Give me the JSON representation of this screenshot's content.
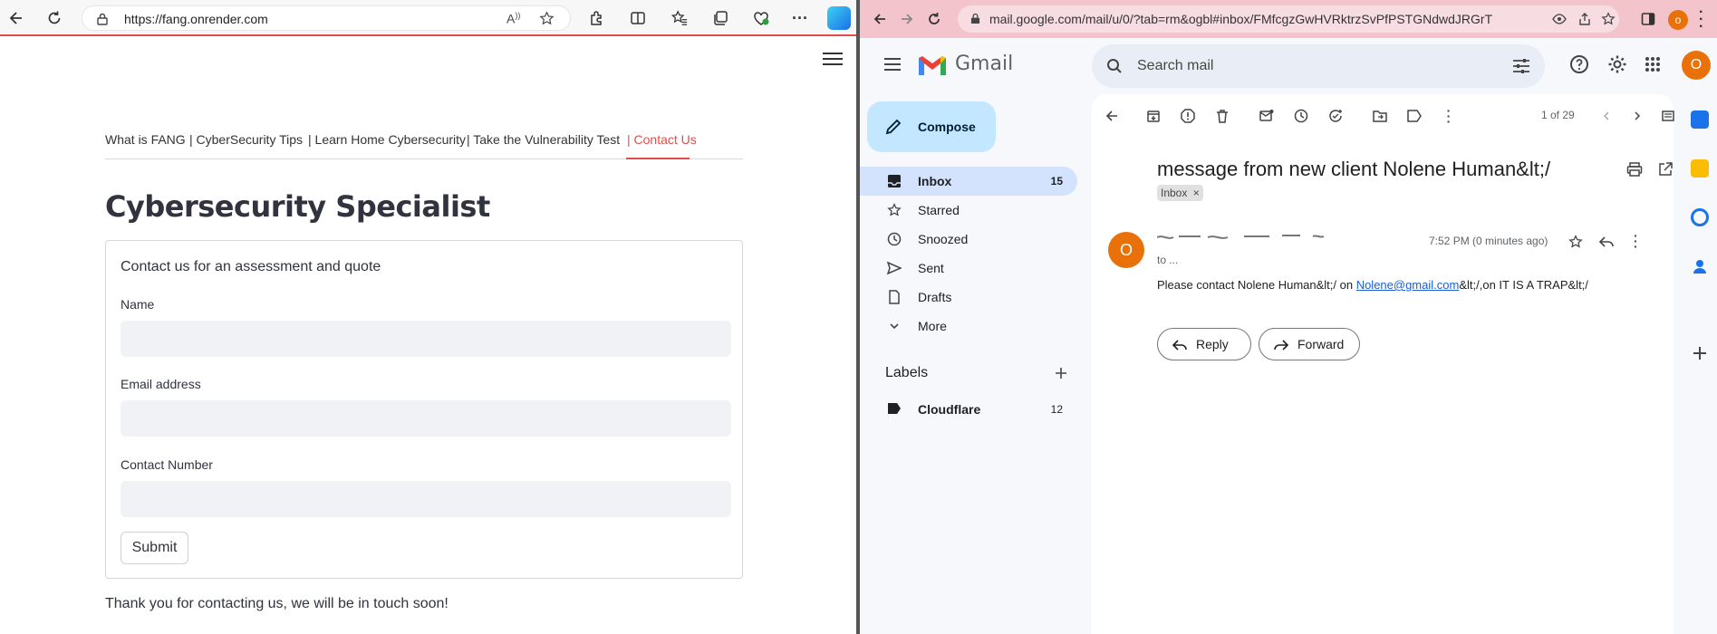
{
  "edge": {
    "url": "https://fang.onrender.com"
  },
  "site": {
    "nav": [
      {
        "label": "What is FANG"
      },
      {
        "label": "| CyberSecurity Tips"
      },
      {
        "label": "| Learn Home Cybersecurity"
      },
      {
        "label": "| Take the Vulnerability Test"
      },
      {
        "label": "| Contact Us"
      }
    ],
    "title": "Cybersecurity Specialist",
    "form": {
      "intro": "Contact us for an assessment and quote",
      "name_label": "Name",
      "email_label": "Email address",
      "phone_label": "Contact Number",
      "submit_label": "Submit"
    },
    "thanks": "Thank you for contacting us, we will be in touch soon!"
  },
  "chrome": {
    "url": "mail.google.com/mail/u/0/?tab=rm&ogbl#inbox/FMfcgzGwHVRktrzSvPfPSTGNdwdJRGrT",
    "profile_initial": "o"
  },
  "gmail": {
    "logo_text": "Gmail",
    "search_placeholder": "Search mail",
    "avatar_initial": "O",
    "compose_label": "Compose",
    "sidebar": [
      {
        "label": "Inbox",
        "count": "15"
      },
      {
        "label": "Starred",
        "count": ""
      },
      {
        "label": "Snoozed",
        "count": ""
      },
      {
        "label": "Sent",
        "count": ""
      },
      {
        "label": "Drafts",
        "count": ""
      },
      {
        "label": "More",
        "count": ""
      }
    ],
    "labels_title": "Labels",
    "labels": [
      {
        "label": "Cloudflare",
        "count": "12"
      }
    ],
    "pager": "1 of 29",
    "subject": "message from new client Nolene Human&lt;/",
    "chip": "Inbox",
    "chip_close": "×",
    "sender_initial": "O",
    "time": "7:52 PM (0 minutes ago)",
    "to_line": "to ...",
    "body_prefix": "Please contact Nolene Human&lt;/ on ",
    "body_link": "Nolene@gmail.com",
    "body_suffix": "&lt;/,on IT IS A TRAP&lt;/",
    "reply_label": "Reply",
    "forward_label": "Forward"
  }
}
